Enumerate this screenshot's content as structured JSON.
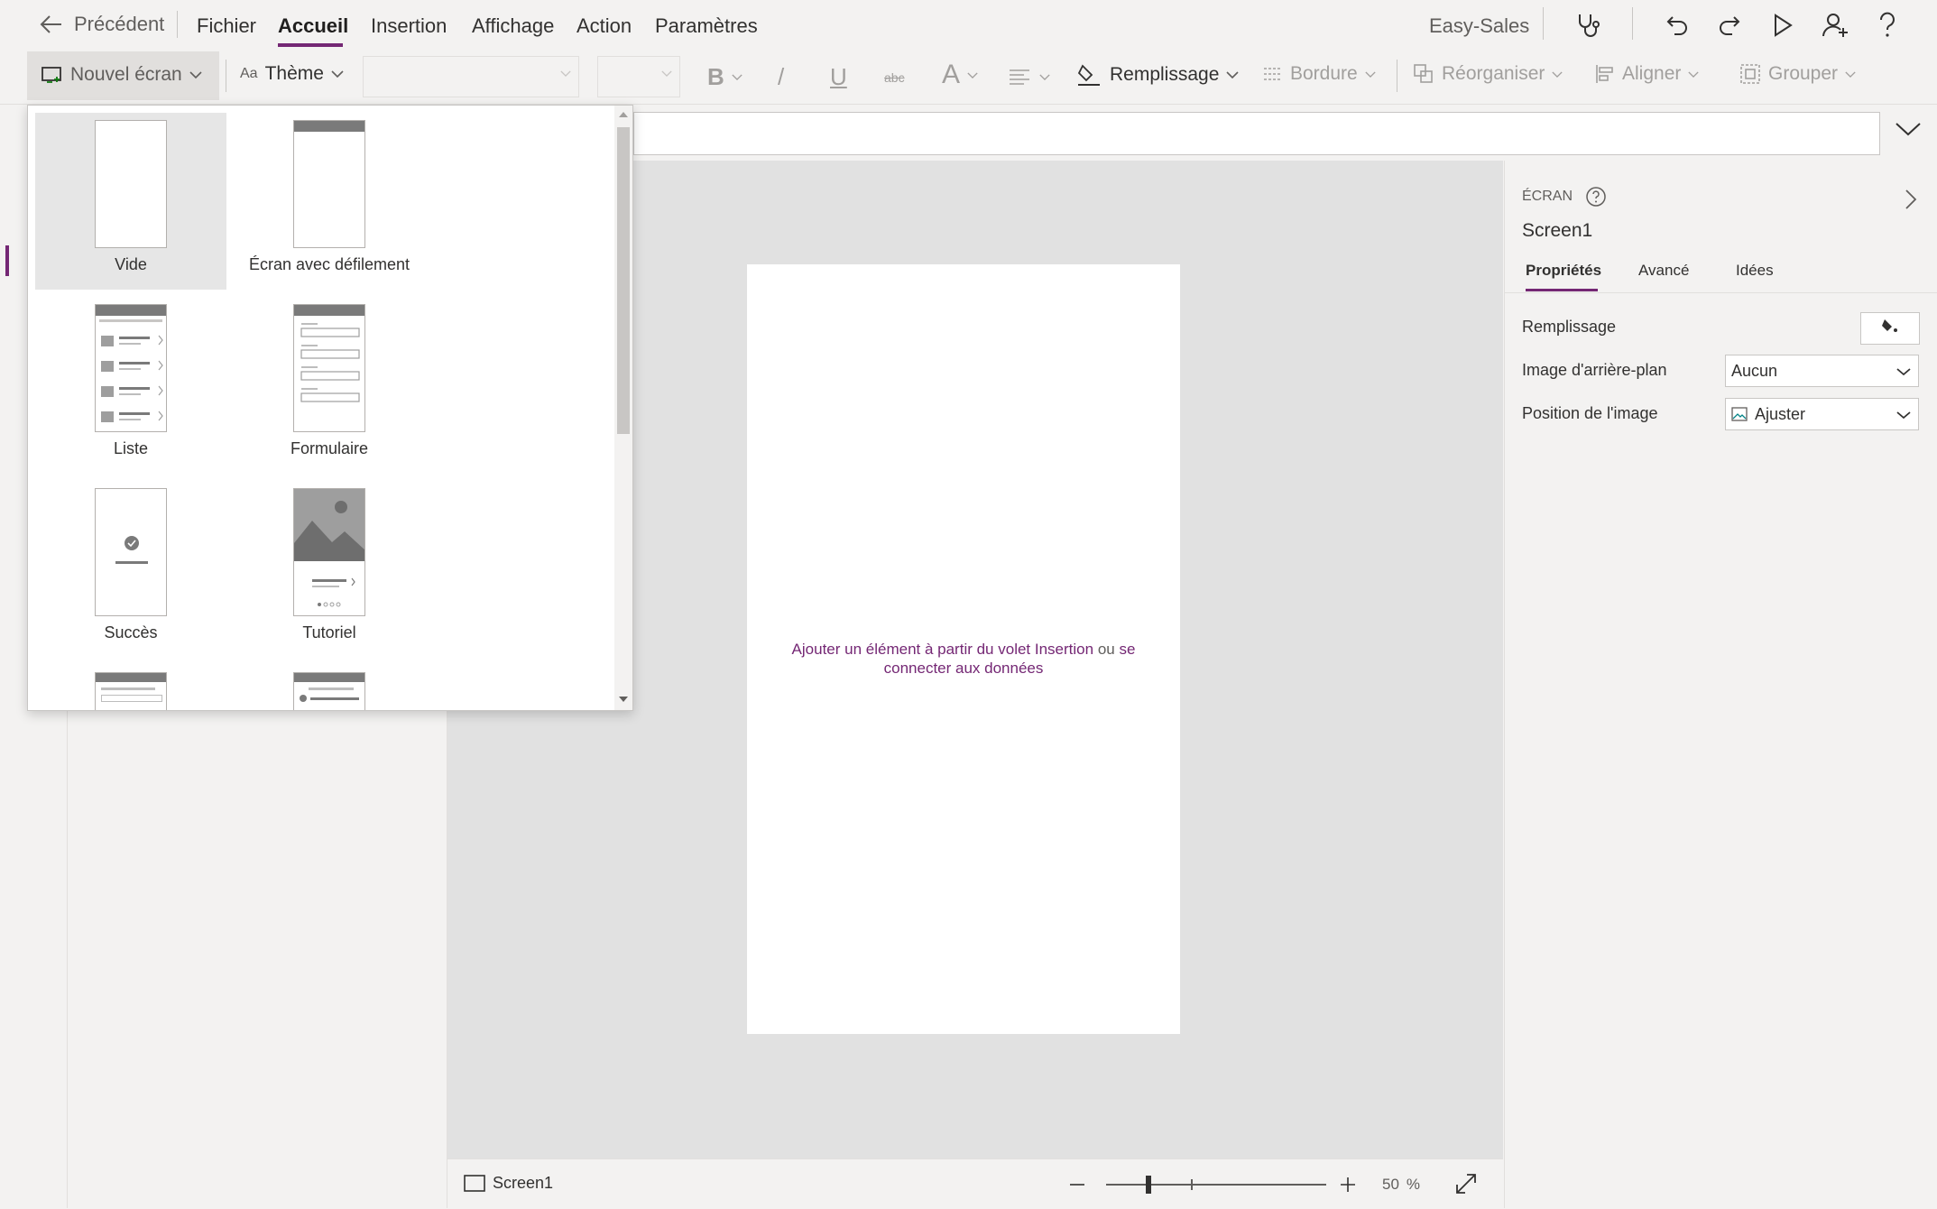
{
  "topbar": {
    "back_label": "Précédent",
    "menus": [
      "Fichier",
      "Accueil",
      "Insertion",
      "Affichage",
      "Action",
      "Paramètres"
    ],
    "app_name": "Easy-Sales"
  },
  "ribbon": {
    "new_screen": "Nouvel écran",
    "theme": "Thème",
    "bold": "B",
    "italic": "/",
    "underline": "U",
    "strike": "abc",
    "font_color": "A",
    "fill": "Remplissage",
    "border": "Bordure",
    "reorder": "Réorganiser",
    "align": "Aligner",
    "group": "Grouper"
  },
  "newscreen_menu": {
    "items": [
      "Vide",
      "Écran avec défilement",
      "Liste",
      "Formulaire",
      "Succès",
      "Tutoriel"
    ],
    "selected": "Vide"
  },
  "canvas": {
    "hint_link1": "Ajouter un élément à partir du volet Insertion",
    "hint_or": "ou",
    "hint_link2a": "se",
    "hint_link2b": "connecter aux données"
  },
  "statusbar": {
    "screen_name": "Screen1",
    "zoom_value": "50",
    "zoom_unit": "%",
    "zoom_level": 0.5
  },
  "props": {
    "section": "ÉCRAN",
    "screen_name": "Screen1",
    "tabs": [
      "Propriétés",
      "Avancé",
      "Idées"
    ],
    "fill_label": "Remplissage",
    "bg_image_label": "Image d'arrière-plan",
    "bg_image_value": "Aucun",
    "image_position_label": "Position de l'image",
    "image_position_value": "Ajuster"
  },
  "colors": {
    "accent": "#742774"
  }
}
